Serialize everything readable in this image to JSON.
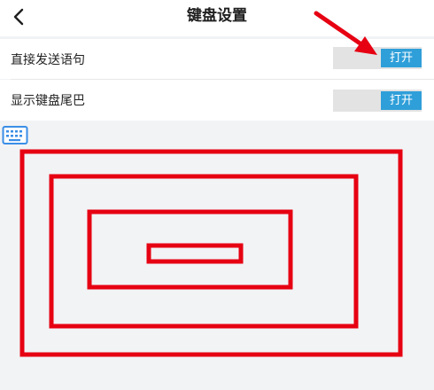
{
  "header": {
    "title": "键盘设置",
    "back_icon": "chevron-left-icon"
  },
  "settings": [
    {
      "label": "直接发送语句",
      "toggle_label": "打开",
      "state": "on"
    },
    {
      "label": "显示键盘尾巴",
      "toggle_label": "打开",
      "state": "on"
    }
  ],
  "keyboard_icon": "keyboard-icon",
  "annotation": {
    "color": "#e60012",
    "arrow_icon": "red-arrow-icon",
    "boxes_icon": "nested-rectangles-graphic"
  },
  "colors": {
    "toggle_on": "#2f9fd9",
    "toggle_track": "#e3e3e3",
    "background": "#f2f3f5"
  }
}
